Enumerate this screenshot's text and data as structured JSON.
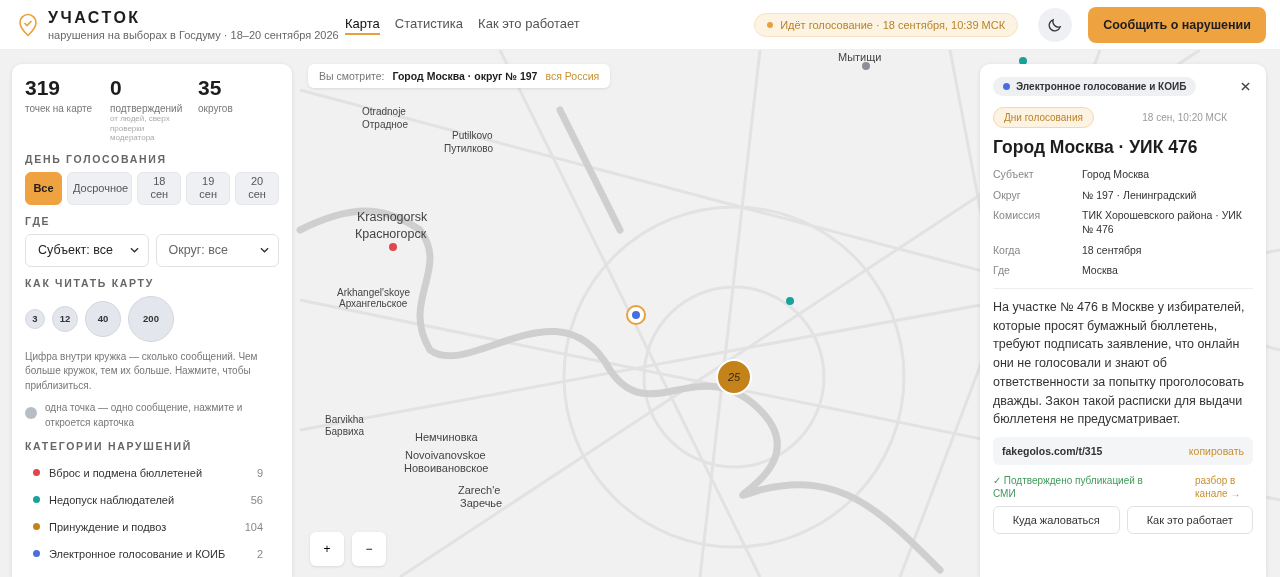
{
  "header": {
    "title": "УЧАСТОК",
    "subtitle": "нарушения на выборах в Госдуму · 18–20 сентября 2026",
    "nav": [
      {
        "label": "Карта",
        "selected": true
      },
      {
        "label": "Статистика",
        "selected": false
      },
      {
        "label": "Как это работает",
        "selected": false
      }
    ],
    "status": "Идёт голосование · 18 сентября, 10:39 МСК",
    "report_button": "Сообщить о нарушении"
  },
  "sidebar": {
    "stats": [
      {
        "value": "319",
        "label": "точек на карте"
      },
      {
        "value": "0",
        "label": "подтверждений",
        "note": "от людей, сверх проверки модератора"
      },
      {
        "value": "35",
        "label": "округов"
      }
    ],
    "day": {
      "title": "ДЕНЬ ГОЛОСОВАНИЯ",
      "options": [
        {
          "label": "Все",
          "selected": true
        },
        {
          "label": "Досрочное",
          "selected": false
        },
        {
          "label": "18 сен",
          "selected": false
        },
        {
          "label": "19 сен",
          "selected": false
        },
        {
          "label": "20 сен",
          "selected": false
        }
      ]
    },
    "where": {
      "title": "ГДЕ",
      "filters": [
        {
          "value": "Субъект: все"
        },
        {
          "value": "Округ: все"
        }
      ]
    },
    "legend": {
      "title": "КАК ЧИТАТЬ КАРТУ",
      "sizes": [
        "3",
        "12",
        "40",
        "200"
      ],
      "explanation": "Цифра внутри кружка — сколько сообщений. Чем больше кружок, тем их больше. Нажмите, чтобы приблизиться.",
      "single_point": "одна точка — одно сообщение, нажмите и откроется карточка"
    },
    "categories": {
      "title": "КАТЕГОРИИ НАРУШЕНИЙ",
      "items": [
        {
          "label": "Вброс и подмена бюллетеней",
          "count": "9",
          "color": "#e0474c"
        },
        {
          "label": "Недопуск наблюдателей",
          "count": "56",
          "color": "#17a398"
        },
        {
          "label": "Принуждение и подвоз",
          "count": "104",
          "color": "#c4821a"
        },
        {
          "label": "Электронное голосование и КОИБ",
          "count": "2",
          "color": "#4a6ee0"
        }
      ]
    }
  },
  "breadcrumb": {
    "prefix": "Вы смотрите:",
    "current": "Город Москва · округ № 197",
    "link": "вся Россия"
  },
  "map": {
    "labels": [
      "Мытищи",
      "Otradnoje",
      "Отрадное",
      "Putilkovo",
      "Путилково",
      "Krasnogorsk",
      "Красногорск",
      "Arkhangel'skoye",
      "Архангельское",
      "Barvikha",
      "Барвиха",
      "Немчиновка",
      "Novoivanovskoe",
      "Новоивановское",
      "Zarech'e",
      "Заречье"
    ],
    "markers": [
      {
        "kind": "point",
        "color": "#8a8f98"
      },
      {
        "kind": "point",
        "color": "#17a398"
      },
      {
        "kind": "point",
        "color": "#e0474c"
      },
      {
        "kind": "point",
        "color": "#17a398"
      },
      {
        "kind": "selected",
        "color": "#4a6ee0"
      },
      {
        "kind": "cluster",
        "color": "#c4821a",
        "count": "25"
      }
    ]
  },
  "zoom_controls": [
    "+",
    "−"
  ],
  "card": {
    "category": {
      "label": "Электронное голосование и КОИБ",
      "color": "#4a6ee0"
    },
    "phase": "Дни голосования",
    "time": "18 сен, 10:20 МСК",
    "title": "Город Москва · УИК 476",
    "fields": [
      {
        "label": "Субъект",
        "value": "Город Москва"
      },
      {
        "label": "Округ",
        "value": "№ 197 · Ленинградский"
      },
      {
        "label": "Комиссия",
        "value": "ТИК Хорошевского района · УИК № 476"
      },
      {
        "label": "Когда",
        "value": "18 сентября"
      },
      {
        "label": "Где",
        "value": "Москва"
      }
    ],
    "description": "На участке № 476 в Москве у избирателей, которые просят бумажный бюллетень, требуют подписать заявление, что онлайн они не голосовали и знают об ответственности за попытку проголосовать дважды. Закон такой расписки для выдачи бюллетеня не предусматривает.",
    "link": {
      "url": "fakegolos.com/t/315",
      "action": "копировать"
    },
    "confirmation": "✓ Подтверждено публикацией в СМИ",
    "channel_link": "разбор в канале →",
    "buttons": [
      "Куда жаловаться",
      "Как это работает"
    ]
  }
}
